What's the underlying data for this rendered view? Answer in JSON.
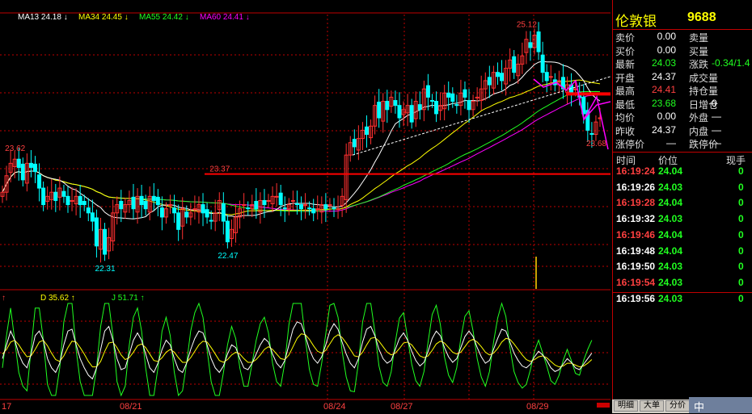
{
  "stock": {
    "name": "伦敦银",
    "code": "9688"
  },
  "quote": {
    "rows": [
      {
        "label": "卖价",
        "value": "0.00",
        "vclass": "w",
        "label2": "卖量",
        "value2": "",
        "v2class": "w"
      },
      {
        "label": "买价",
        "value": "0.00",
        "vclass": "w",
        "label2": "买量",
        "value2": "",
        "v2class": "w"
      },
      {
        "label": "最新",
        "value": "24.03",
        "vclass": "g",
        "label2": "涨跌",
        "value2": "-0.34/1.4",
        "v2class": "g"
      },
      {
        "label": "开盘",
        "value": "24.37",
        "vclass": "w",
        "label2": "成交量",
        "value2": "",
        "v2class": "w"
      },
      {
        "label": "最高",
        "value": "24.41",
        "vclass": "r",
        "label2": "持仓量",
        "value2": "",
        "v2class": "w"
      },
      {
        "label": "最低",
        "value": "23.68",
        "vclass": "g",
        "label2": "日增仓",
        "value2": "0",
        "v2class": "w"
      },
      {
        "label": "均价",
        "value": "0.00",
        "vclass": "w",
        "label2": "外盘",
        "value2": "—",
        "v2class": "w"
      },
      {
        "label": "昨收",
        "value": "24.37",
        "vclass": "w",
        "label2": "内盘",
        "value2": "—",
        "v2class": "w"
      },
      {
        "label": "涨停价",
        "value": "—",
        "vclass": "w",
        "label2": "跌停价",
        "value2": "—",
        "v2class": "w"
      }
    ]
  },
  "ticks": {
    "headers": {
      "time": "时间",
      "price": "价位",
      "vol": "现手"
    },
    "rows": [
      {
        "time": "16:19:24",
        "price": "24.04",
        "vol": "0",
        "tclass": "r"
      },
      {
        "time": "16:19:26",
        "price": "24.03",
        "vol": "0",
        "tclass": "w"
      },
      {
        "time": "16:19:28",
        "price": "24.04",
        "vol": "0",
        "tclass": "r"
      },
      {
        "time": "16:19:32",
        "price": "24.03",
        "vol": "0",
        "tclass": "w"
      },
      {
        "time": "16:19:46",
        "price": "24.04",
        "vol": "0",
        "tclass": "r"
      },
      {
        "time": "16:19:48",
        "price": "24.04",
        "vol": "0",
        "tclass": "w"
      },
      {
        "time": "16:19:50",
        "price": "24.03",
        "vol": "0",
        "tclass": "w"
      },
      {
        "time": "16:19:54",
        "price": "24.03",
        "vol": "0",
        "tclass": "r"
      },
      {
        "time": "16:19:56",
        "price": "24.03",
        "vol": "0",
        "tclass": "w"
      }
    ]
  },
  "tabs": [
    "明细",
    "大单",
    "分价"
  ],
  "ime": {
    "text": "中"
  },
  "colors": {
    "ma13": "#ffffff",
    "ma34": "#ffff00",
    "ma55": "#20ff20",
    "ma60": "#ff00ff",
    "up": "#ff3030",
    "down": "#00ffff",
    "grid": "#c00000"
  },
  "chart_data": [
    {
      "type": "candlestick",
      "legend": [
        {
          "label": "MA13 24.18 ↓",
          "color": "#ffffff"
        },
        {
          "label": "MA34 24.45 ↓",
          "color": "#ffff00"
        },
        {
          "label": "MA55 24.42 ↓",
          "color": "#20ff20"
        },
        {
          "label": "MA60 24.41 ↓",
          "color": "#ff00ff"
        }
      ],
      "ylim": [
        22.0,
        25.3
      ],
      "x_ticks": [
        "17",
        "08/21",
        "08/24",
        "08/27",
        "08/29"
      ],
      "price_labels": [
        {
          "text": "23.62",
          "value": 23.62,
          "index": 3
        },
        {
          "text": "22.31",
          "value": 22.31,
          "index": 25
        },
        {
          "text": "23.37",
          "value": 23.37,
          "index": 53
        },
        {
          "text": "22.47",
          "value": 22.47,
          "index": 55
        },
        {
          "text": "25.12",
          "value": 25.12,
          "index": 128
        },
        {
          "text": "23.68",
          "value": 23.68,
          "index": 145
        }
      ],
      "support_level": 23.37,
      "resistance_level": 24.34,
      "closes": [
        23.15,
        23.35,
        23.5,
        23.55,
        23.45,
        23.3,
        23.5,
        23.45,
        23.4,
        23.2,
        23.0,
        23.1,
        23.15,
        23.05,
        23.2,
        23.1,
        23.0,
        23.05,
        23.1,
        23.0,
        23.0,
        22.9,
        22.8,
        22.5,
        22.7,
        22.4,
        22.6,
        22.9,
        23.0,
        22.95,
        23.0,
        23.05,
        22.95,
        23.1,
        23.0,
        22.95,
        23.1,
        23.05,
        23.0,
        22.85,
        22.95,
        23.0,
        22.9,
        22.7,
        22.95,
        22.85,
        22.9,
        22.95,
        23.0,
        22.9,
        22.85,
        22.8,
        22.9,
        23.05,
        22.8,
        22.55,
        22.7,
        22.85,
        22.95,
        23.0,
        22.95,
        23.0,
        22.95,
        23.05,
        23.0,
        23.05,
        23.1,
        23.1,
        23.0,
        22.95,
        23.0,
        23.05,
        23.0,
        22.95,
        23.0,
        22.95,
        22.9,
        22.95,
        23.0,
        22.95,
        23.0,
        22.95,
        22.95,
        23.1,
        23.6,
        23.75,
        23.7,
        23.8,
        23.9,
        23.85,
        23.95,
        24.2,
        24.05,
        24.25,
        24.15,
        24.3,
        24.2,
        24.05,
        24.15,
        24.2,
        24.0,
        24.25,
        24.15,
        24.4,
        24.3,
        24.25,
        24.1,
        24.2,
        24.35,
        24.3,
        24.25,
        24.2,
        24.35,
        24.3,
        24.15,
        24.25,
        24.3,
        24.4,
        24.5,
        24.45,
        24.6,
        24.55,
        24.5,
        24.65,
        24.75,
        24.6,
        24.7,
        24.8,
        25.0,
        24.9,
        25.05,
        24.85,
        24.6,
        24.5,
        24.55,
        24.45,
        24.5,
        24.4,
        24.45,
        24.35,
        24.4,
        24.3,
        24.1,
        23.9,
        23.85,
        24.0,
        24.05
      ]
    },
    {
      "type": "line",
      "indicator": "KDJ",
      "legend": [
        {
          "label": "D 35.62 ↑",
          "color": "#ffff00"
        },
        {
          "label": "J 51.71 ↑",
          "color": "#20ff20"
        }
      ],
      "ylim": [
        0,
        100
      ],
      "k": [
        40,
        55,
        70,
        60,
        45,
        35,
        30,
        45,
        65,
        70,
        60,
        40,
        30,
        25,
        35,
        55,
        70,
        72,
        55,
        40,
        30,
        22,
        18,
        30,
        50,
        70,
        75,
        60,
        40,
        28,
        30,
        45,
        60,
        68,
        60,
        45,
        30,
        25,
        35,
        50,
        60,
        55,
        40,
        28,
        25,
        35,
        50,
        62,
        70,
        68,
        55,
        40,
        30,
        25,
        32,
        45,
        55,
        52,
        40,
        30,
        28,
        35,
        45,
        55,
        62,
        58,
        45,
        35,
        30,
        38,
        55,
        72,
        80,
        78,
        65,
        50,
        40,
        35,
        42,
        55,
        70,
        78,
        72,
        58,
        45,
        35,
        30,
        40,
        58,
        72,
        75,
        65,
        50,
        40,
        35,
        38,
        50,
        62,
        68,
        60,
        48,
        38,
        32,
        36,
        48,
        62,
        70,
        65,
        52,
        42,
        36,
        40,
        52,
        64,
        70,
        64,
        52,
        42,
        35,
        38,
        50,
        62,
        72,
        70,
        58,
        46,
        38,
        32,
        30,
        34,
        42,
        48,
        44,
        38,
        30,
        26,
        28,
        34,
        40,
        36,
        30,
        28,
        34,
        40,
        46
      ],
      "d": [
        45,
        50,
        58,
        60,
        55,
        48,
        42,
        43,
        50,
        58,
        60,
        54,
        46,
        39,
        37,
        43,
        52,
        59,
        58,
        52,
        45,
        37,
        31,
        31,
        37,
        48,
        57,
        58,
        52,
        44,
        39,
        41,
        47,
        54,
        56,
        52,
        45,
        38,
        37,
        41,
        47,
        50,
        47,
        41,
        36,
        36,
        41,
        48,
        55,
        59,
        58,
        52,
        45,
        38,
        36,
        39,
        44,
        47,
        45,
        40,
        36,
        36,
        39,
        44,
        50,
        53,
        50,
        45,
        40,
        39,
        44,
        53,
        62,
        67,
        66,
        61,
        54,
        48,
        46,
        49,
        56,
        63,
        66,
        63,
        57,
        50,
        43,
        42,
        47,
        55,
        62,
        63,
        59,
        53,
        47,
        44,
        46,
        51,
        57,
        58,
        55,
        49,
        43,
        41,
        43,
        49,
        56,
        59,
        57,
        52,
        47,
        45,
        47,
        53,
        59,
        61,
        58,
        53,
        47,
        44,
        46,
        51,
        58,
        62,
        61,
        56,
        50,
        44,
        39,
        37,
        39,
        42,
        43,
        41,
        37,
        33,
        31,
        32,
        35,
        35,
        33,
        31,
        32,
        35,
        39
      ],
      "j": [
        30,
        65,
        95,
        60,
        25,
        10,
        5,
        50,
        95,
        95,
        60,
        12,
        0,
        0,
        30,
        80,
        100,
        100,
        50,
        15,
        0,
        0,
        0,
        30,
        75,
        100,
        100,
        65,
        15,
        0,
        10,
        55,
        85,
        95,
        70,
        30,
        0,
        0,
        30,
        70,
        85,
        65,
        25,
        0,
        5,
        35,
        70,
        90,
        100,
        85,
        50,
        15,
        0,
        0,
        25,
        55,
        75,
        62,
        30,
        10,
        10,
        35,
        60,
        78,
        85,
        68,
        35,
        15,
        10,
        36,
        77,
        100,
        100,
        100,
        62,
        28,
        12,
        10,
        35,
        67,
        98,
        100,
        85,
        48,
        20,
        5,
        4,
        36,
        80,
        100,
        100,
        69,
        32,
        14,
        10,
        26,
        58,
        84,
        90,
        62,
        34,
        16,
        10,
        26,
        58,
        88,
        98,
        77,
        42,
        22,
        14,
        30,
        62,
        86,
        92,
        70,
        40,
        20,
        10,
        26,
        58,
        84,
        100,
        86,
        52,
        26,
        14,
        8,
        12,
        28,
        48,
        60,
        46,
        32,
        16,
        12,
        22,
        38,
        50,
        38,
        24,
        22,
        38,
        50,
        60
      ]
    }
  ]
}
